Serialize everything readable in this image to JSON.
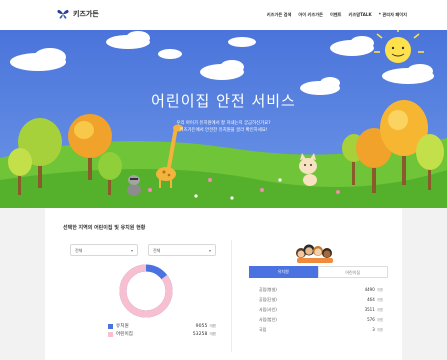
{
  "header": {
    "logo_text": "키즈가든",
    "nav": [
      "키즈가든 검색",
      "아이 키즈가든",
      "이벤트",
      "키즈맘TALK",
      "* 관리자 페이지"
    ]
  },
  "hero": {
    "title": "어린이집 안전 서비스",
    "subtitle_line1": "우리 아이가 유치원에서 잘 지내는지 궁금하신가요?",
    "subtitle_line2": "키즈가든에서 안전한 유치원을 골라 확인하세요!"
  },
  "main": {
    "section_title": "선택한 지역의 어린이집 및 유치원 현황",
    "select1": "전체",
    "select2": "전체",
    "legend": [
      {
        "label": "유치원",
        "value": "9055",
        "unit": "개원",
        "color": "#4a72e0"
      },
      {
        "label": "어린이집",
        "value": "53258",
        "unit": "개원",
        "color": "#f7bfd0"
      }
    ],
    "tabs": [
      "유치원",
      "어린이집"
    ],
    "stats": [
      {
        "label": "공립(병설)",
        "value": "4490",
        "unit": "개원"
      },
      {
        "label": "공립(단설)",
        "value": "464",
        "unit": "개원"
      },
      {
        "label": "사립(사인)",
        "value": "3511",
        "unit": "개원"
      },
      {
        "label": "사립(법인)",
        "value": "576",
        "unit": "개원"
      },
      {
        "label": "국립",
        "value": "3",
        "unit": "개원"
      }
    ]
  }
}
